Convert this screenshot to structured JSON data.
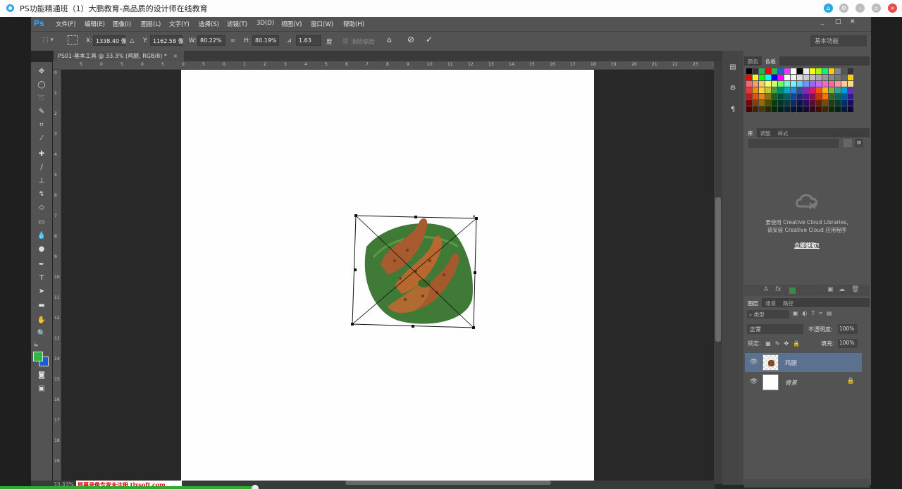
{
  "window": {
    "title": "PS功能精通班（1）大鹏教育-高品质的设计师在线教育",
    "controls": [
      "pin",
      "settings",
      "minimize",
      "restore",
      "close"
    ]
  },
  "app": {
    "logo": "Ps",
    "menu": [
      "文件(F)",
      "编辑(E)",
      "图像(I)",
      "图层(L)",
      "文字(Y)",
      "选择(S)",
      "滤镜(T)",
      "3D(D)",
      "视图(V)",
      "窗口(W)",
      "帮助(H)"
    ],
    "window_controls": [
      "_",
      "□",
      "✕"
    ],
    "workspace": "基本功能"
  },
  "options_bar": {
    "x_label": "X:",
    "x_value": "1338.40 像",
    "y_label": "Y:",
    "y_value": "1162.58 像",
    "w_label": "W:",
    "w_value": "80.22%",
    "h_label": "H:",
    "h_value": "80.19%",
    "angle_value": "1.63",
    "angle_unit": "度",
    "interp_label": "消除锯齿"
  },
  "document": {
    "tab_label": "PS01-基本工具 @ 33.3% (鸡腿, RGB/8) *",
    "zoom": "33.33%"
  },
  "rulers": {
    "top": [
      "5",
      "0",
      "5",
      "0",
      "5",
      "0",
      "5",
      "0",
      "1",
      "2",
      "3",
      "4",
      "5",
      "6",
      "7",
      "8",
      "9",
      "10",
      "11",
      "12",
      "13",
      "14",
      "15",
      "16",
      "17",
      "18",
      "19",
      "20",
      "21",
      "22",
      "23",
      "24",
      "25"
    ],
    "left": [
      "0",
      "1",
      "2",
      "3",
      "4",
      "5",
      "6",
      "7",
      "8",
      "9",
      "10",
      "11",
      "12",
      "13",
      "14",
      "15",
      "16",
      "17",
      "18",
      "19"
    ]
  },
  "panels": {
    "swatch_tabs": [
      "颜色",
      "色板"
    ],
    "library_tabs": [
      "库",
      "调整",
      "样式"
    ],
    "library_message_1": "要使用 Creative Cloud Libraries,",
    "library_message_2": "请安装 Creative Cloud 应用程序",
    "library_link": "立即获取!",
    "layer_tabs": [
      "图层",
      "通道",
      "路径"
    ],
    "filter_kind": "类型",
    "blend_mode": "正常",
    "opacity_label": "不透明度:",
    "opacity": "100%",
    "lock_label": "锁定:",
    "fill_label": "填充:",
    "fill": "100%",
    "layers": [
      {
        "name": "鸡腿",
        "selected": true
      },
      {
        "name": "背景",
        "selected": false,
        "locked": true
      }
    ]
  },
  "recorder_watermark": "屏幕录像专家未注册 tlxsoft.com",
  "colors": {
    "foreground": "#2fb64a",
    "background": "#1a5fd0",
    "accent": "#31a8ff"
  }
}
